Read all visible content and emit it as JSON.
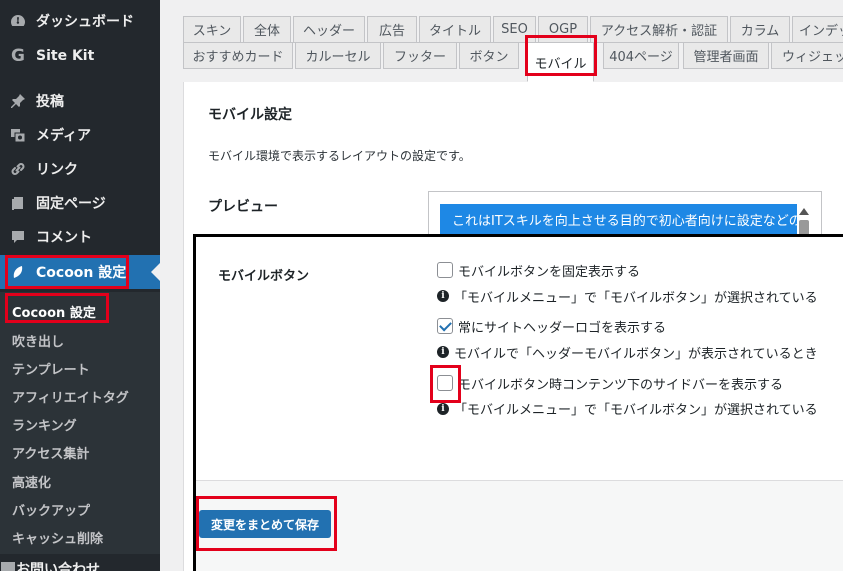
{
  "sidebar": {
    "items": [
      {
        "label": "ダッシュボード",
        "icon": "dashboard-icon"
      },
      {
        "label": "Site Kit",
        "icon": "google-g-icon"
      },
      {
        "label": "投稿",
        "icon": "pin-icon"
      },
      {
        "label": "メディア",
        "icon": "media-icon"
      },
      {
        "label": "リンク",
        "icon": "link-icon"
      },
      {
        "label": "固定ページ",
        "icon": "page-icon"
      },
      {
        "label": "コメント",
        "icon": "comment-icon"
      },
      {
        "label": "Cocoon 設定",
        "icon": "cocoon-leaf-icon"
      }
    ],
    "submenu": [
      "Cocoon 設定",
      "吹き出し",
      "テンプレート",
      "アフィリエイトタグ",
      "ランキング",
      "アクセス集計",
      "高速化",
      "バックアップ",
      "キャッシュ削除"
    ],
    "bottom_item": "お問い合わせ"
  },
  "tabs": {
    "row1": [
      "スキン",
      "全体",
      "ヘッダー",
      "広告",
      "タイトル",
      "SEO",
      "OGP",
      "アクセス解析・認証",
      "カラム",
      "インデックス"
    ],
    "row2": [
      "おすすめカード",
      "カルーセル",
      "フッター",
      "ボタン",
      "モバイル",
      "404ページ",
      "管理者画面",
      "ウィジェット"
    ],
    "active": "モバイル"
  },
  "content": {
    "section_title": "モバイル設定",
    "section_desc": "モバイル環境で表示するレイアウトの設定です。",
    "preview_label": "プレビュー",
    "preview_text": "これはITスキルを向上させる目的で初心者向けに設定などの",
    "mobile_button_label": "モバイルボタン",
    "options": [
      {
        "label": "モバイルボタンを固定表示する",
        "checked": false,
        "note": "「モバイルメニュー」で「モバイルボタン」が選択されている"
      },
      {
        "label": "常にサイトヘッダーロゴを表示する",
        "checked": true,
        "note": "モバイルで「ヘッダーモバイルボタン」が表示されているとき"
      },
      {
        "label": "モバイルボタン時コンテンツ下のサイドバーを表示する",
        "checked": false,
        "note": "「モバイルメニュー」で「モバイルボタン」が選択されている"
      }
    ],
    "save_label": "変更をまとめて保存"
  },
  "colors": {
    "sidebar_bg": "#23282d",
    "accent": "#2271b1",
    "highlight": "#e3001b"
  }
}
